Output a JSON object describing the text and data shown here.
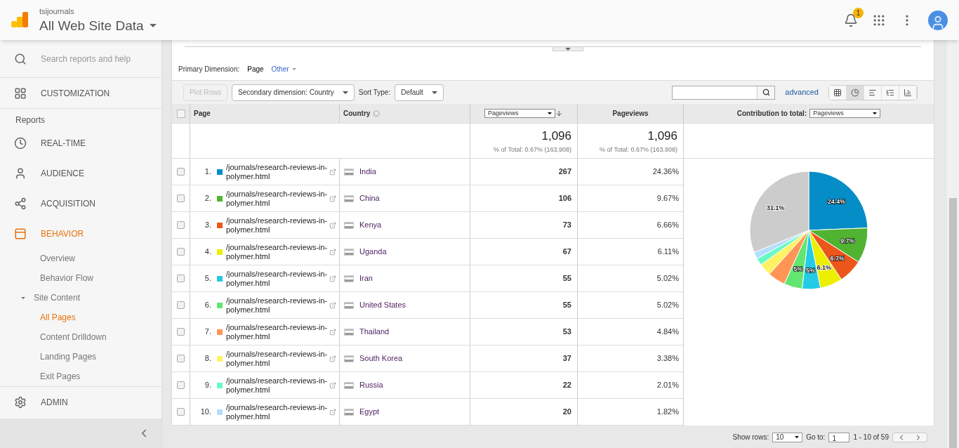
{
  "header": {
    "account": "tsijournals",
    "property": "All Web Site Data",
    "notifications": "1"
  },
  "sidebar": {
    "search_placeholder": "Search reports and help",
    "items": [
      {
        "kind": "nav",
        "label": "CUSTOMIZATION",
        "selected": false
      },
      {
        "kind": "heading",
        "label": "Reports"
      },
      {
        "kind": "nav",
        "label": "REAL-TIME",
        "selected": false
      },
      {
        "kind": "nav",
        "label": "AUDIENCE",
        "selected": false
      },
      {
        "kind": "nav",
        "label": "ACQUISITION",
        "selected": false
      },
      {
        "kind": "nav",
        "label": "BEHAVIOR",
        "selected": true,
        "children": [
          {
            "label": "Overview",
            "selected": false
          },
          {
            "label": "Behavior Flow",
            "selected": false
          },
          {
            "label": "Site Content",
            "selected": false,
            "expanded": true,
            "children": [
              {
                "label": "All Pages",
                "selected": true
              },
              {
                "label": "Content Drilldown",
                "selected": false
              },
              {
                "label": "Landing Pages",
                "selected": false
              },
              {
                "label": "Exit Pages",
                "selected": false
              }
            ]
          }
        ]
      },
      {
        "kind": "nav",
        "label": "ADMIN",
        "selected": false
      }
    ]
  },
  "primary_dimension": {
    "label": "Primary Dimension:",
    "options": [
      {
        "label": "Page",
        "selected": true
      },
      {
        "label": "Other",
        "selected": false
      }
    ]
  },
  "toolbar": {
    "plot_rows": {
      "label": "Plot Rows",
      "disabled": true
    },
    "secondary_dimension": "Secondary dimension: Country",
    "sort_label": "Sort Type:",
    "sort_value": "Default",
    "advanced": "advanced",
    "views": [
      {
        "selected": false
      },
      {
        "selected": true
      },
      {
        "selected": false
      },
      {
        "selected": false
      },
      {
        "selected": false
      }
    ]
  },
  "table": {
    "columns": {
      "page": "Page",
      "country": "Country",
      "metric_select": "Pageviews",
      "metric": "Pageviews",
      "contribution_label": "Contribution to total:",
      "contribution_select": "Pageviews"
    },
    "select_all": {
      "checked": false
    },
    "totals": [
      {
        "value": "1,096",
        "note": "% of Total: 0.67% (163,908)"
      },
      {
        "value": "1,096",
        "note": "% of Total: 0.67% (163,908)"
      }
    ],
    "rows": [
      {
        "index": "1.",
        "color": "#058dc7",
        "page": "/journals/research-reviews-in-polymer.html",
        "country": "India",
        "pageviews": "267",
        "percent": "24.36%",
        "checked": false
      },
      {
        "index": "2.",
        "color": "#50b432",
        "page": "/journals/research-reviews-in-polymer.html",
        "country": "China",
        "pageviews": "106",
        "percent": "9.67%",
        "checked": false
      },
      {
        "index": "3.",
        "color": "#ed561b",
        "page": "/journals/research-reviews-in-polymer.html",
        "country": "Kenya",
        "pageviews": "73",
        "percent": "6.66%",
        "checked": false
      },
      {
        "index": "4.",
        "color": "#edef00",
        "page": "/journals/research-reviews-in-polymer.html",
        "country": "Uganda",
        "pageviews": "67",
        "percent": "6.11%",
        "checked": false
      },
      {
        "index": "5.",
        "color": "#24cbe5",
        "page": "/journals/research-reviews-in-polymer.html",
        "country": "Iran",
        "pageviews": "55",
        "percent": "5.02%",
        "checked": false
      },
      {
        "index": "6.",
        "color": "#64e572",
        "page": "/journals/research-reviews-in-polymer.html",
        "country": "United States",
        "pageviews": "55",
        "percent": "5.02%",
        "checked": false
      },
      {
        "index": "7.",
        "color": "#ff9655",
        "page": "/journals/research-reviews-in-polymer.html",
        "country": "Thailand",
        "pageviews": "53",
        "percent": "4.84%",
        "checked": false
      },
      {
        "index": "8.",
        "color": "#fff263",
        "page": "/journals/research-reviews-in-polymer.html",
        "country": "South Korea",
        "pageviews": "37",
        "percent": "3.38%",
        "checked": false
      },
      {
        "index": "9.",
        "color": "#6af9c4",
        "page": "/journals/research-reviews-in-polymer.html",
        "country": "Russia",
        "pageviews": "22",
        "percent": "2.01%",
        "checked": false
      },
      {
        "index": "10.",
        "color": "#b2deff",
        "page": "/journals/research-reviews-in-polymer.html",
        "country": "Egypt",
        "pageviews": "20",
        "percent": "1.82%",
        "checked": false
      }
    ],
    "chart_data": {
      "type": "pie",
      "values": [
        24.36,
        9.67,
        6.66,
        6.11,
        5.02,
        5.02,
        4.84,
        3.38,
        2.01,
        1.82,
        31.11
      ],
      "value_labels": [
        "24.4%",
        "9.7%",
        "6.7%",
        "6.1%",
        "5%",
        "5%",
        null,
        null,
        null,
        null,
        "31.1%"
      ]
    }
  },
  "footer": {
    "show_rows_label": "Show rows:",
    "show_rows_value": "10",
    "goto_label": "Go to:",
    "goto_value": "1",
    "range": "1 - 10 of 59"
  }
}
